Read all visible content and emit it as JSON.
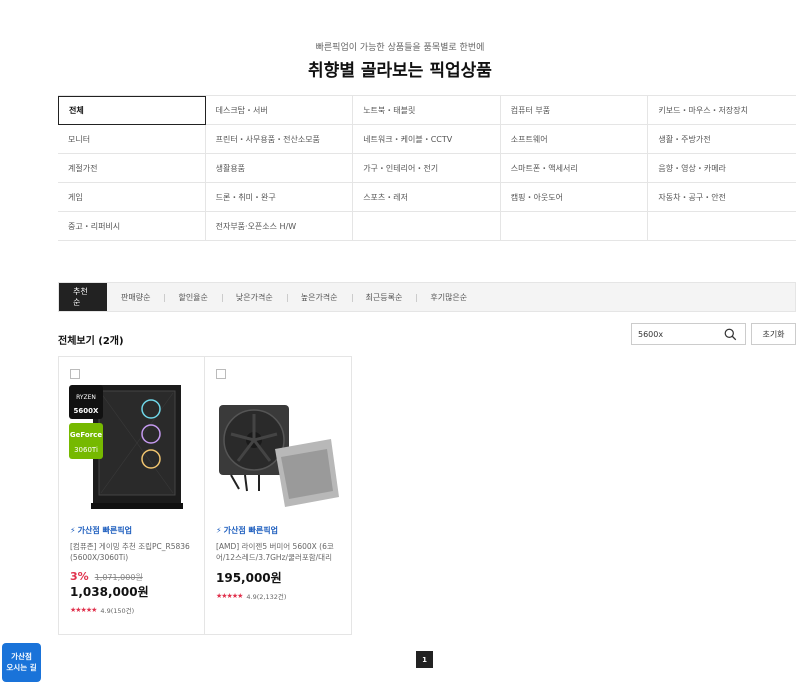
{
  "header": {
    "subtitle": "빠른픽업이 가능한 상품들을 품목별로 한번에",
    "title": "취향별 골라보는 픽업상품"
  },
  "categories": [
    "전체",
    "데스크탑・서버",
    "노트북・태블릿",
    "컴퓨터 부품",
    "키보드・마우스・저장장치",
    "모니터",
    "프린터・사무용품・전산소모품",
    "네트워크・케이블・CCTV",
    "소프트웨어",
    "생활・주방가전",
    "계절가전",
    "생활용품",
    "가구・인테리어・전기",
    "스마트폰・액세서리",
    "음향・영상・카메라",
    "게임",
    "드론・취미・완구",
    "스포츠・레저",
    "캠핑・아웃도어",
    "자동차・공구・안전",
    "중고・리퍼비시",
    "전자부품·오픈소스 H/W",
    "",
    "",
    ""
  ],
  "sort_tabs": [
    "추천순",
    "판매량순",
    "할인율순",
    "낮은가격순",
    "높은가격순",
    "최근등록순",
    "후기많은순"
  ],
  "list": {
    "count_label": "전체보기 (2개)",
    "search_value": "5600x",
    "reset_label": "초기화"
  },
  "products": [
    {
      "badge": "가산점 빠른픽업",
      "name": "[컴퓨존] 게이밍 추천 조립PC_R5836 (5600X/3060Ti)",
      "discount": "3%",
      "original_price": "1,071,000원",
      "price": "1,038,000원",
      "stars": "★★★★★",
      "rating": "4.9(150건)",
      "tag1_line1": "RYZEN",
      "tag1_line2": "5600X",
      "tag2_line1": "GeForce",
      "tag2_line2": "3060Ti"
    },
    {
      "badge": "가산점 빠른픽업",
      "name": "[AMD] 라이젠5 버미어 5600X (6코어/12스레드/3.7GHz/쿨러포함/대리",
      "price": "195,000원",
      "stars": "★★★★★",
      "rating": "4.9(2,132건)"
    }
  ],
  "pagination": {
    "current": "1"
  },
  "floating": {
    "line1": "가산점",
    "line2": "오시는 길"
  },
  "colors": {
    "accent_blue": "#1f5fbf",
    "discount_red": "#e0324d",
    "active_dark": "#222222"
  }
}
